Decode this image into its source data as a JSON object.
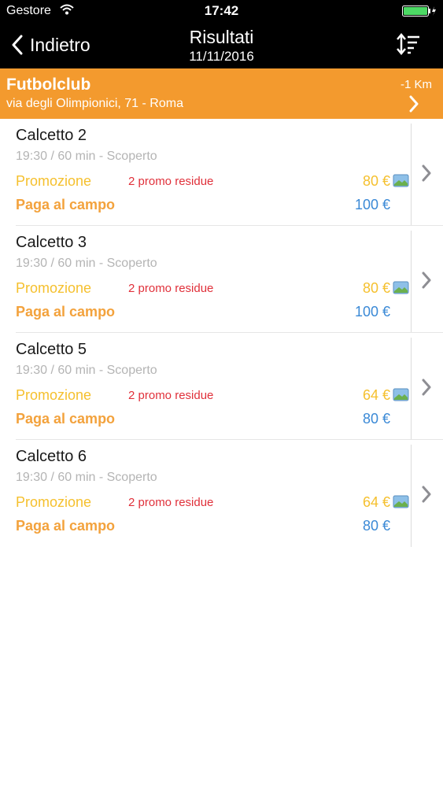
{
  "status": {
    "carrier": "Gestore",
    "time": "17:42"
  },
  "nav": {
    "back_label": "Indietro",
    "title": "Risultati",
    "date": "11/11/2016"
  },
  "club": {
    "name": "Futbolclub",
    "address": "via degli Olimpionici, 71 - Roma",
    "distance": "-1 Km"
  },
  "results": [
    {
      "name": "Calcetto 2",
      "details": "19:30 / 60 min - Scoperto",
      "promo_label": "Promozione",
      "promo_remaining": "2 promo residue",
      "promo_price": "80 €",
      "pay_label": "Paga al campo",
      "pay_price": "100 €"
    },
    {
      "name": "Calcetto 3",
      "details": "19:30 / 60 min - Scoperto",
      "promo_label": "Promozione",
      "promo_remaining": "2 promo residue",
      "promo_price": "80 €",
      "pay_label": "Paga al campo",
      "pay_price": "100 €"
    },
    {
      "name": "Calcetto 5",
      "details": "19:30 / 60 min - Scoperto",
      "promo_label": "Promozione",
      "promo_remaining": "2 promo residue",
      "promo_price": "64 €",
      "pay_label": "Paga al campo",
      "pay_price": "80 €"
    },
    {
      "name": "Calcetto 6",
      "details": "19:30 / 60 min - Scoperto",
      "promo_label": "Promozione",
      "promo_remaining": "2 promo residue",
      "promo_price": "64 €",
      "pay_label": "Paga al campo",
      "pay_price": "80 €"
    }
  ],
  "colors": {
    "nav_bg": "#000000",
    "club_bg": "#f39a2e",
    "promo": "#f5c02e",
    "promo_remaining": "#e0303a",
    "pay_label": "#f3a23c",
    "pay_price": "#3a89d6"
  }
}
